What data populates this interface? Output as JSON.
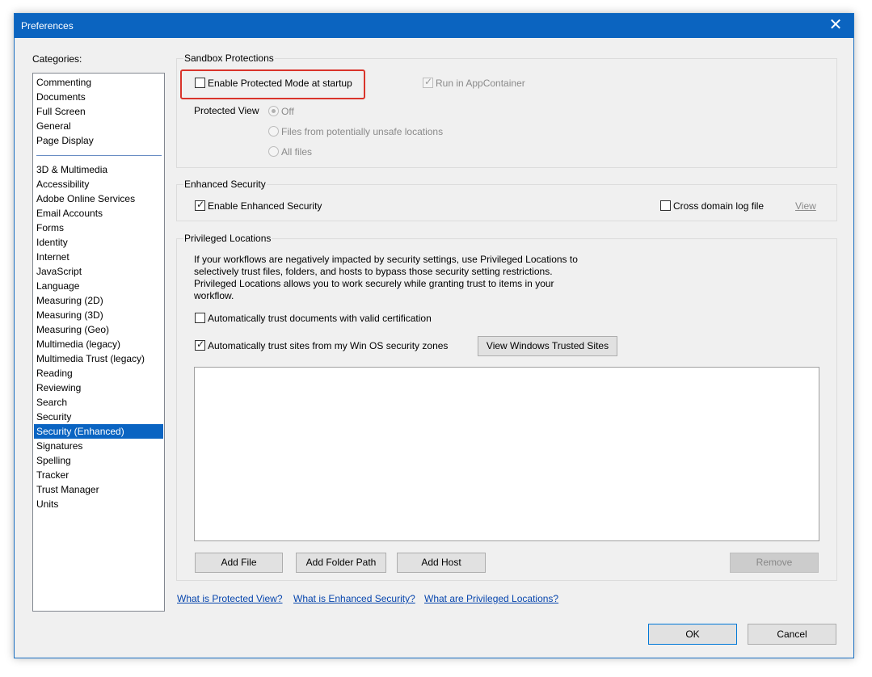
{
  "window": {
    "title": "Preferences",
    "close_glyph": "✕"
  },
  "categories": {
    "label": "Categories:",
    "group1": [
      "Commenting",
      "Documents",
      "Full Screen",
      "General",
      "Page Display"
    ],
    "group2": [
      "3D & Multimedia",
      "Accessibility",
      "Adobe Online Services",
      "Email Accounts",
      "Forms",
      "Identity",
      "Internet",
      "JavaScript",
      "Language",
      "Measuring (2D)",
      "Measuring (3D)",
      "Measuring (Geo)",
      "Multimedia (legacy)",
      "Multimedia Trust (legacy)",
      "Reading",
      "Reviewing",
      "Search",
      "Security",
      "Security (Enhanced)",
      "Signatures",
      "Spelling",
      "Tracker",
      "Trust Manager",
      "Units"
    ],
    "selected": "Security (Enhanced)"
  },
  "sandbox": {
    "title": "Sandbox Protections",
    "protected_mode_label": "Enable Protected Mode at startup",
    "protected_mode_checked": false,
    "appcontainer_label": "Run in AppContainer",
    "appcontainer_checked": true,
    "protected_view_label": "Protected View",
    "pv_off": "Off",
    "pv_unsafe": "Files from potentially unsafe locations",
    "pv_all": "All files",
    "pv_selected": "Off"
  },
  "enhanced": {
    "title": "Enhanced Security",
    "enable_label": "Enable Enhanced Security",
    "enable_checked": true,
    "cross_domain_label": "Cross domain log file",
    "cross_domain_checked": false,
    "view_link": "View"
  },
  "privileged": {
    "title": "Privileged Locations",
    "desc1": "If your workflows are negatively impacted by security settings, use Privileged Locations to",
    "desc2": "selectively trust files, folders, and hosts to bypass those security setting restrictions.",
    "desc3": "Privileged Locations allows you to work securely while granting trust to items in your",
    "desc4": "workflow.",
    "auto_cert_label": "Automatically trust documents with valid certification",
    "auto_cert_checked": false,
    "auto_sites_label": "Automatically trust sites from my Win OS security zones",
    "auto_sites_checked": true,
    "view_trusted_btn": "View Windows Trusted Sites",
    "add_file_btn": "Add File",
    "add_folder_btn": "Add Folder Path",
    "add_host_btn": "Add Host",
    "remove_btn": "Remove"
  },
  "links": {
    "protected_view": "What is Protected View?",
    "enhanced_security": "What is Enhanced Security?",
    "privileged_locations": "What are Privileged Locations?"
  },
  "footer": {
    "ok": "OK",
    "cancel": "Cancel"
  },
  "colors": {
    "titlebar": "#0b64c0",
    "selection": "#0a64c2",
    "highlight": "#d9342b",
    "link": "#0645ad"
  }
}
